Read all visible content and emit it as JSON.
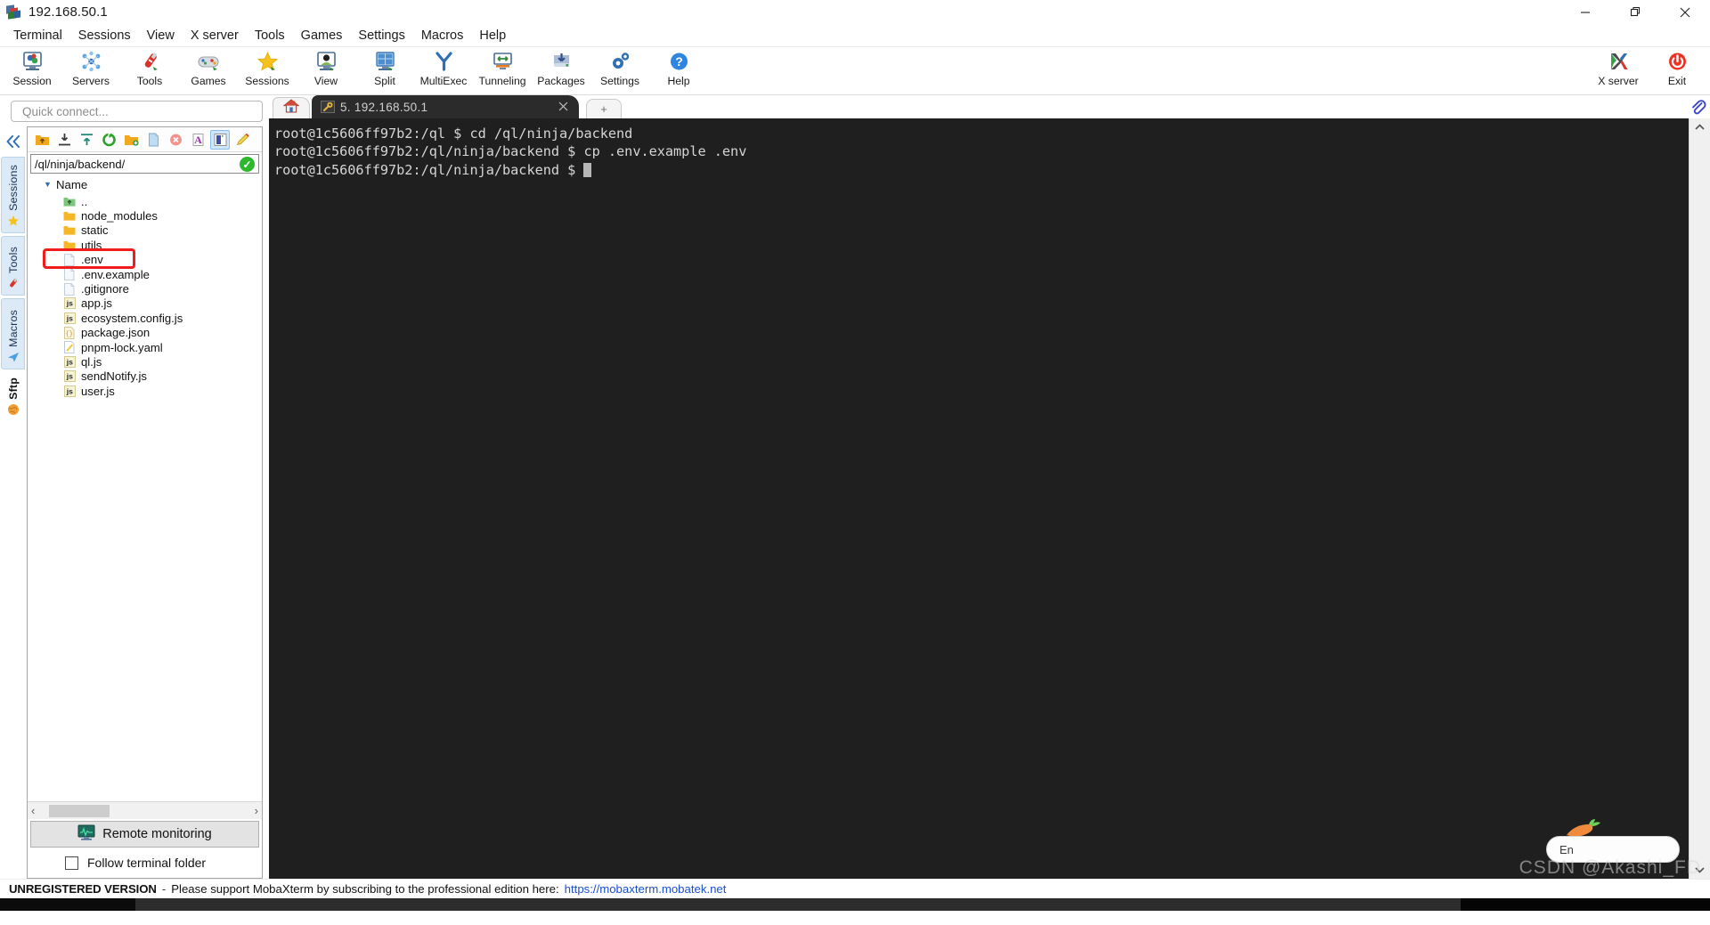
{
  "window": {
    "title": "192.168.50.1",
    "icon": "mobaxterm-logo-icon",
    "minimize": "minimize-icon",
    "maximize": "maximize-icon",
    "close": "close-icon"
  },
  "menubar": {
    "items": [
      {
        "label": "Terminal"
      },
      {
        "label": "Sessions"
      },
      {
        "label": "View"
      },
      {
        "label": "X server"
      },
      {
        "label": "Tools"
      },
      {
        "label": "Games"
      },
      {
        "label": "Settings"
      },
      {
        "label": "Macros"
      },
      {
        "label": "Help"
      }
    ]
  },
  "toolbar": {
    "buttons": [
      {
        "label": "Session",
        "icon": "session-icon"
      },
      {
        "label": "Servers",
        "icon": "servers-icon"
      },
      {
        "label": "Tools",
        "icon": "tools-icon"
      },
      {
        "label": "Games",
        "icon": "games-icon"
      },
      {
        "label": "Sessions",
        "icon": "sessions-star-icon"
      },
      {
        "label": "View",
        "icon": "view-icon"
      },
      {
        "label": "Split",
        "icon": "split-icon"
      },
      {
        "label": "MultiExec",
        "icon": "multiexec-icon"
      },
      {
        "label": "Tunneling",
        "icon": "tunneling-icon"
      },
      {
        "label": "Packages",
        "icon": "packages-icon"
      },
      {
        "label": "Settings",
        "icon": "settings-gear-icon"
      },
      {
        "label": "Help",
        "icon": "help-question-icon"
      }
    ],
    "right_buttons": [
      {
        "label": "X server",
        "icon": "xserver-icon"
      },
      {
        "label": "Exit",
        "icon": "power-exit-icon"
      }
    ]
  },
  "quick_connect": {
    "placeholder": "Quick connect..."
  },
  "side_tabs": {
    "collapse_icon": "collapse-chevrons-icon",
    "items": [
      {
        "label": "Sessions",
        "icon": "star-icon",
        "active": false
      },
      {
        "label": "Tools",
        "icon": "swiss-knife-icon",
        "active": false
      },
      {
        "label": "Macros",
        "icon": "paper-plane-icon",
        "active": false
      },
      {
        "label": "Sftp",
        "icon": "globe-icon",
        "active": true
      }
    ]
  },
  "file_browser": {
    "toolbar_icons": [
      {
        "name": "go-up-folder-icon",
        "selected": false
      },
      {
        "name": "download-icon",
        "selected": false
      },
      {
        "name": "upload-icon",
        "selected": false
      },
      {
        "name": "refresh-icon",
        "selected": false
      },
      {
        "name": "new-folder-icon",
        "selected": false
      },
      {
        "name": "new-file-icon",
        "selected": false
      },
      {
        "name": "delete-icon",
        "selected": false
      },
      {
        "name": "text-mode-icon",
        "selected": false
      },
      {
        "name": "view-pane-icon",
        "selected": true
      },
      {
        "name": "edit-highlight-icon",
        "selected": false
      }
    ],
    "path": "/ql/ninja/backend/",
    "path_status_icon": "check-ok-icon",
    "column_header": "Name",
    "sort_caret_icon": "caret-down-icon",
    "entries": [
      {
        "name": "..",
        "type": "parent",
        "icon": "up-folder-icon",
        "highlighted": false
      },
      {
        "name": "node_modules",
        "type": "folder",
        "icon": "folder-icon",
        "highlighted": false
      },
      {
        "name": "static",
        "type": "folder",
        "icon": "folder-icon",
        "highlighted": false
      },
      {
        "name": "utils",
        "type": "folder",
        "icon": "folder-icon",
        "highlighted": false
      },
      {
        "name": ".env",
        "type": "file",
        "icon": "blank-file-icon",
        "highlighted": true
      },
      {
        "name": ".env.example",
        "type": "file",
        "icon": "blank-file-icon",
        "highlighted": false
      },
      {
        "name": ".gitignore",
        "type": "file",
        "icon": "blank-file-icon",
        "highlighted": false
      },
      {
        "name": "app.js",
        "type": "js",
        "icon": "js-file-icon",
        "highlighted": false
      },
      {
        "name": "ecosystem.config.js",
        "type": "js",
        "icon": "js-file-icon",
        "highlighted": false
      },
      {
        "name": "package.json",
        "type": "json",
        "icon": "json-file-icon",
        "highlighted": false
      },
      {
        "name": "pnpm-lock.yaml",
        "type": "yaml",
        "icon": "yaml-file-icon",
        "highlighted": false
      },
      {
        "name": "ql.js",
        "type": "js",
        "icon": "js-file-icon",
        "highlighted": false
      },
      {
        "name": "sendNotify.js",
        "type": "js",
        "icon": "js-file-icon",
        "highlighted": false
      },
      {
        "name": "user.js",
        "type": "js",
        "icon": "js-file-icon",
        "highlighted": false
      }
    ],
    "scroll_left_icon": "chevron-left-icon",
    "scroll_right_icon": "chevron-right-icon",
    "remote_monitoring": {
      "label": "Remote monitoring",
      "icon": "monitor-graph-icon"
    },
    "follow_terminal_folder": {
      "label": "Follow terminal folder",
      "checked": false
    }
  },
  "tabs": {
    "home_tab_icon": "home-icon",
    "session_tab": {
      "label": "5. 192.168.50.1",
      "icon": "ssh-key-icon",
      "close_icon": "close-icon"
    },
    "new_tab_label": "+"
  },
  "terminal": {
    "lines": [
      "root@1c5606ff97b2:/ql $ cd /ql/ninja/backend",
      "root@1c5606ff97b2:/ql/ninja/backend $ cp .env.example .env",
      "root@1c5606ff97b2:/ql/ninja/backend $ "
    ],
    "cursor_visible": true,
    "background": "#201f1f",
    "foreground": "#d6d6d6"
  },
  "scrollbar": {
    "up_icon": "chevron-up-icon",
    "down_icon": "chevron-down-icon"
  },
  "attachment": {
    "icon": "paperclip-icon"
  },
  "statusbar": {
    "unregistered": "UNREGISTERED VERSION",
    "dash": "-",
    "message": "Please support MobaXterm by subscribing to the professional edition here:",
    "link": "https://mobaxterm.mobatek.net"
  },
  "watermark": {
    "text": "CSDN @Akashi_FD",
    "ime_label": "En"
  },
  "colors": {
    "accent": "#2f6fb5",
    "terminal_bg": "#201f1f",
    "terminal_fg": "#d6d6d6",
    "highlight_red": "#f01d1d",
    "link_blue": "#1a4fd0",
    "tab_bg": "#2b2b2b",
    "folder_yellow": "#f5b725",
    "ok_green": "#2eb82e"
  }
}
